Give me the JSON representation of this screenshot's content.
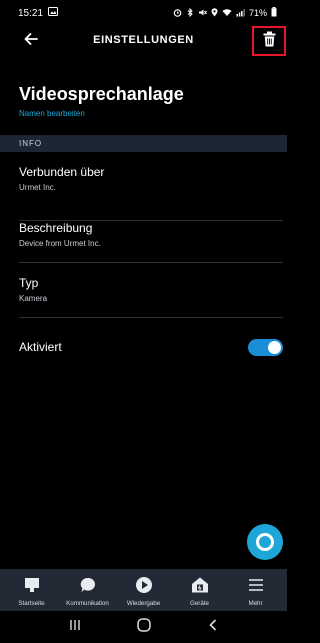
{
  "status_bar": {
    "time": "15:21",
    "battery": "71%"
  },
  "app_bar": {
    "title": "EINSTELLUNGEN",
    "highlight_color": "#e8162a"
  },
  "device": {
    "name": "Videosprechanlage",
    "edit_link": "Namen bearbeiten"
  },
  "section": {
    "label": "INFO"
  },
  "info_rows": [
    {
      "title": "Verbunden über",
      "value": "Urmet Inc."
    },
    {
      "title": "Beschreibung",
      "value": "Device from Urmet Inc."
    },
    {
      "title": "Typ",
      "value": "Kamera"
    }
  ],
  "enabled_toggle": {
    "label": "Aktiviert",
    "on": true,
    "accent_color": "#1a8fd8"
  },
  "bottom_nav": [
    {
      "label": "Startseite",
      "icon": "home-icon"
    },
    {
      "label": "Kommunikation",
      "icon": "chat-bubble-icon"
    },
    {
      "label": "Wiedergabe",
      "icon": "play-icon"
    },
    {
      "label": "Geräte",
      "icon": "devices-house-icon"
    },
    {
      "label": "Mehr",
      "icon": "menu-icon"
    }
  ]
}
